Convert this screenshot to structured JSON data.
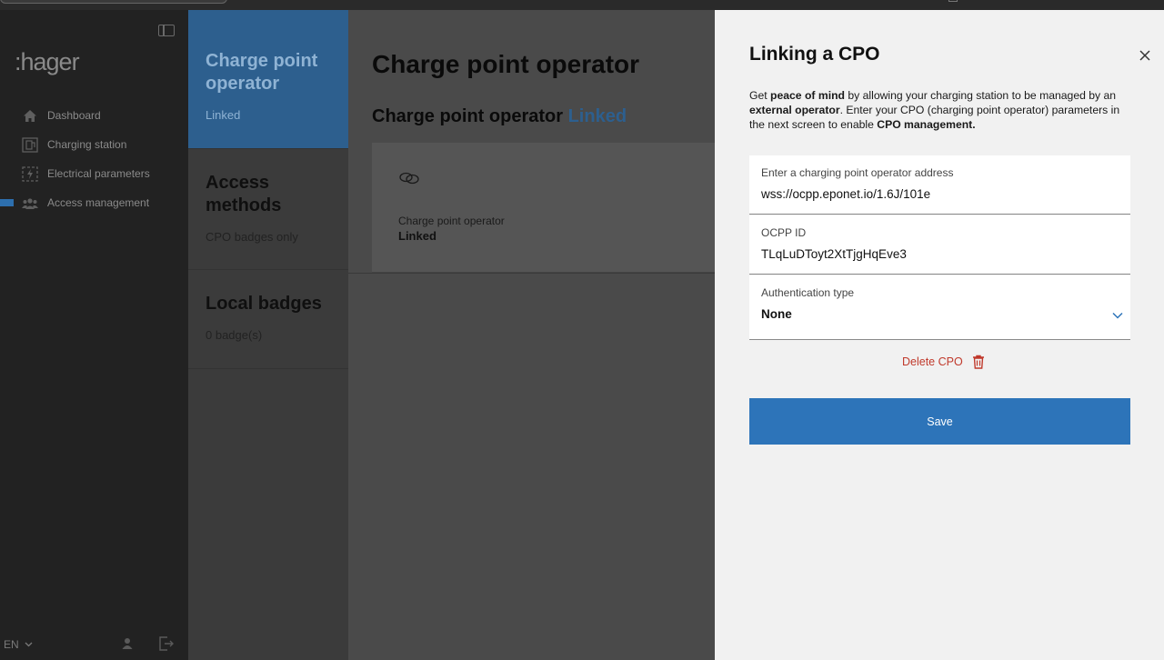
{
  "brand": {
    "logo_text": ":hager"
  },
  "sidebar": {
    "items": [
      {
        "label": "Dashboard",
        "icon": "home-icon"
      },
      {
        "label": "Charging station",
        "icon": "charging-station-icon"
      },
      {
        "label": "Electrical parameters",
        "icon": "electrical-parameters-icon"
      },
      {
        "label": "Access management",
        "icon": "users-icon",
        "active": true
      }
    ],
    "language": "EN"
  },
  "cards": [
    {
      "title": "Charge point operator",
      "sub": "Linked",
      "active": true
    },
    {
      "title": "Access methods",
      "sub": "CPO badges only"
    },
    {
      "title": "Local badges",
      "sub": "0 badge(s)"
    }
  ],
  "main": {
    "title": "Charge point operator",
    "subtitle": "Charge point operator",
    "subtitle_status": "Linked",
    "panel_label": "Charge point operator",
    "panel_value": "Linked"
  },
  "drawer": {
    "title": "Linking a CPO",
    "desc": {
      "p1": "Get ",
      "b1": "peace of mind",
      "p2": " by allowing your charging station to be managed by an ",
      "b2": "external operator",
      "p3": ". Enter your CPO (charging point operator) parameters in the next screen to enable ",
      "b3": "CPO management."
    },
    "address_label": "Enter a charging point operator address",
    "address_value": "wss://ocpp.eponet.io/1.6J/101e",
    "ocpp_label": "OCPP ID",
    "ocpp_value": "TLqLuDToyt2XtTjgHqEve3",
    "auth_label": "Authentication type",
    "auth_value": "None",
    "delete_label": "Delete CPO",
    "save_label": "Save"
  },
  "colors": {
    "accent": "#2d74b9",
    "danger": "#c0392b",
    "drawer_bg": "#f1f1f1"
  }
}
